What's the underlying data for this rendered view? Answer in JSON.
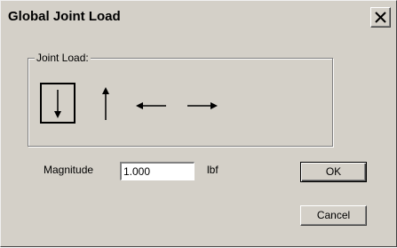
{
  "window": {
    "title": "Global Joint Load"
  },
  "group": {
    "label": "Joint Load:",
    "load_directions": [
      {
        "icon": "arrow-down-icon",
        "selected": true
      },
      {
        "icon": "arrow-up-icon",
        "selected": false
      },
      {
        "icon": "arrow-left-icon",
        "selected": false
      },
      {
        "icon": "arrow-right-icon",
        "selected": false
      }
    ]
  },
  "magnitude": {
    "label": "Magnitude",
    "value": "1.000",
    "unit": "lbf"
  },
  "buttons": {
    "ok": "OK",
    "cancel": "Cancel"
  },
  "colors": {
    "face": "#d4d0c8",
    "shadow": "#808080",
    "highlight": "#ffffff"
  }
}
